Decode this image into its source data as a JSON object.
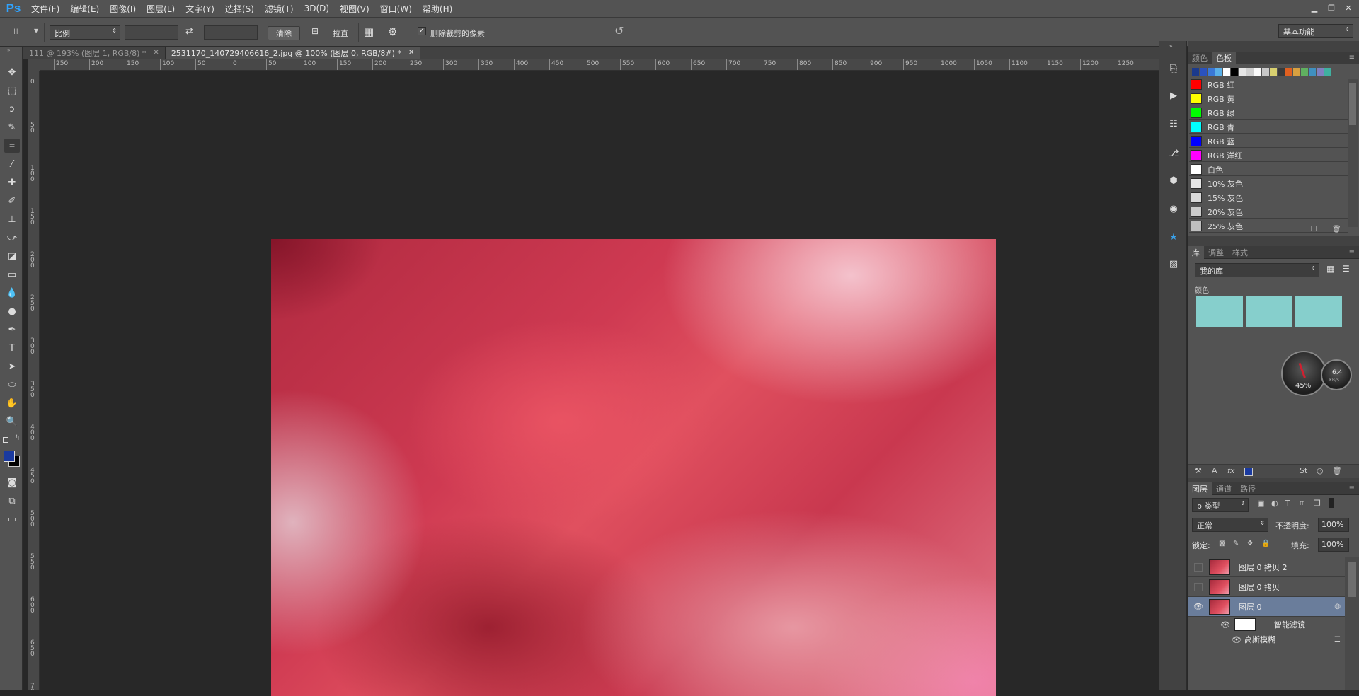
{
  "app": {
    "logo": "Ps"
  },
  "menu": [
    "文件(F)",
    "编辑(E)",
    "图像(I)",
    "图层(L)",
    "文字(Y)",
    "选择(S)",
    "滤镜(T)",
    "3D(D)",
    "视图(V)",
    "窗口(W)",
    "帮助(H)"
  ],
  "window_controls": {
    "minimize": "▁",
    "restore": "❐",
    "close": "✕"
  },
  "options": {
    "ratio_select": "比例",
    "clear_button": "清除",
    "straighten_label": "拉直",
    "delete_cropped_label": "删除裁剪的像素",
    "delete_cropped_checked": true,
    "workspace": "基本功能"
  },
  "tabs": [
    {
      "title": "111 @ 193% (图层 1, RGB/8) *",
      "active": false
    },
    {
      "title": "2531170_140729406616_2.jpg @ 100% (图层 0, RGB/8#) *",
      "active": true
    }
  ],
  "ruler_h": [
    "250",
    "200",
    "150",
    "100",
    "50",
    "0",
    "50",
    "100",
    "150",
    "200",
    "250",
    "300",
    "350",
    "400",
    "450",
    "500",
    "550",
    "600",
    "650",
    "700",
    "750",
    "800",
    "850",
    "900",
    "950",
    "1000",
    "1050",
    "1100",
    "1150",
    "1200",
    "1250"
  ],
  "ruler_v": [
    "0",
    "50",
    "100",
    "150",
    "200",
    "250",
    "300",
    "350",
    "400",
    "450",
    "500",
    "550",
    "600",
    "650",
    "700"
  ],
  "swatches_panel": {
    "tabs": [
      "颜色",
      "色板"
    ],
    "active_tab": "色板",
    "top_colors": [
      "#1b3a8c",
      "#2a52be",
      "#3a78d6",
      "#5ab0e8",
      "#ffffff",
      "#000000",
      "#e6e6e6",
      "#d0d0d0",
      "#fafafa",
      "#c8c8c8",
      "#d8d070",
      "#3a3a3a",
      "#e06020",
      "#d8a040",
      "#60b060",
      "#4090c0",
      "#8080c0",
      "#40b0a0"
    ],
    "items": [
      {
        "name": "RGB 红",
        "color": "#ff0000"
      },
      {
        "name": "RGB 黄",
        "color": "#ffff00"
      },
      {
        "name": "RGB 绿",
        "color": "#00ff00"
      },
      {
        "name": "RGB 青",
        "color": "#00ffff"
      },
      {
        "name": "RGB 蓝",
        "color": "#0000ff"
      },
      {
        "name": "RGB 洋红",
        "color": "#ff00ff"
      },
      {
        "name": "白色",
        "color": "#ffffff"
      },
      {
        "name": "10% 灰色",
        "color": "#e6e6e6"
      },
      {
        "name": "15% 灰色",
        "color": "#d9d9d9"
      },
      {
        "name": "20% 灰色",
        "color": "#cccccc"
      },
      {
        "name": "25% 灰色",
        "color": "#bfbfbf"
      }
    ]
  },
  "library_panel": {
    "tabs": [
      "库",
      "调整",
      "样式"
    ],
    "active_tab": "库",
    "library_select": "我的库",
    "section_label": "颜色",
    "colors": [
      "#86cfcc",
      "#86cfcc",
      "#86cfcc"
    ],
    "gauge_percent": "45%",
    "gauge_speed": "6.4",
    "gauge_unit": "KB/S"
  },
  "layers_panel": {
    "tabs": [
      "图层",
      "通道",
      "路径"
    ],
    "active_tab": "图层",
    "filter_select": "ρ 类型",
    "blend_mode": "正常",
    "opacity_label": "不透明度:",
    "opacity_value": "100%",
    "lock_label": "锁定:",
    "fill_label": "填充:",
    "fill_value": "100%",
    "layers": [
      {
        "name": "图层 0 拷贝 2",
        "visible": false,
        "selected": false
      },
      {
        "name": "图层 0 拷贝",
        "visible": false,
        "selected": false
      },
      {
        "name": "图层 0",
        "visible": true,
        "selected": true
      }
    ],
    "smart_filters_label": "智能滤镜",
    "filter_name": "高斯模糊"
  },
  "colors": {
    "foreground": "#1a3aa0",
    "background": "#000000"
  }
}
